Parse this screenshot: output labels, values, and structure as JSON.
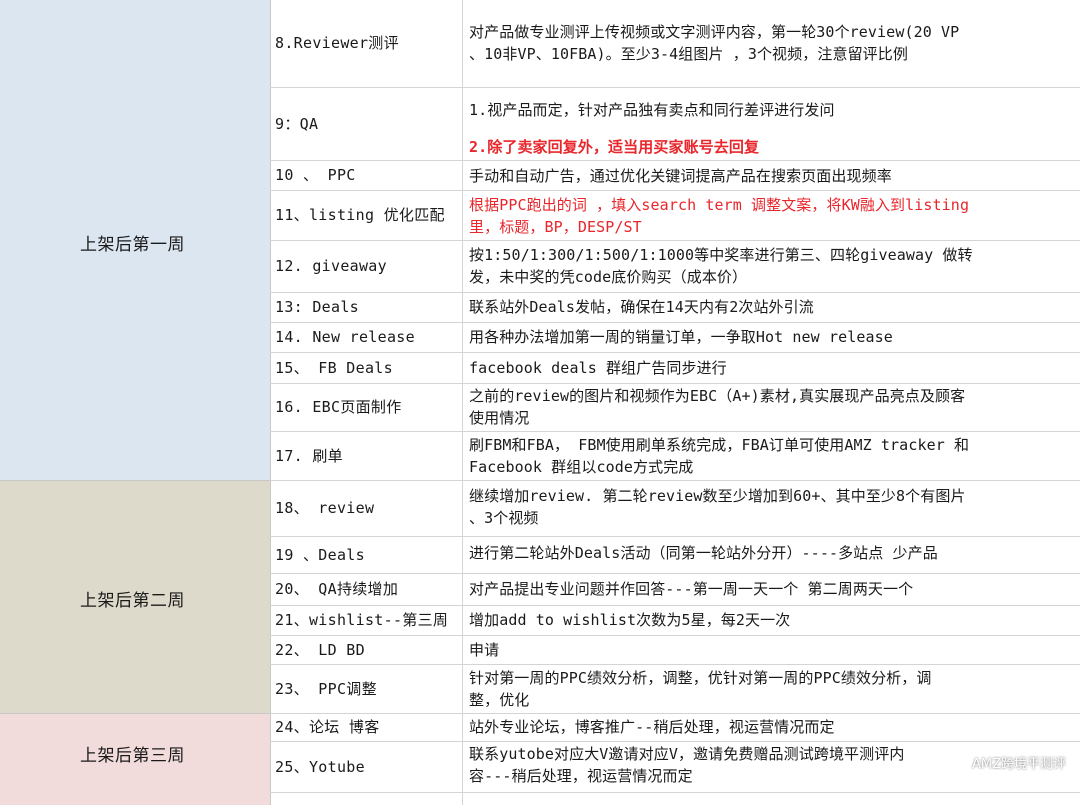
{
  "stages": {
    "week1": "上架后第一周",
    "week2": "上架后第二周",
    "week3": "上架后第三周"
  },
  "colors": {
    "week1": "#dce6f1",
    "week2": "#dedacb",
    "week3": "#f2dcdb",
    "red_text": "#e8262b"
  },
  "rows": [
    {
      "task": "8.Reviewer测评",
      "desc": "对产品做专业测评上传视频或文字测评内容，第一轮30个review(20 VP\n、10非VP、10FBA)。至少3-4组图片 ，3个视频，注意留评比例"
    },
    {
      "task": "9：QA",
      "desc": "1.视产品而定，针对产品独有卖点和同行差评进行发问",
      "desc2": "2.除了卖家回复外，适当用买家账号去回复"
    },
    {
      "task": "10 、 PPC",
      "desc": "手动和自动广告，通过优化关键词提高产品在搜索页面出现频率"
    },
    {
      "task": "11、listing 优化匹配",
      "desc": "根据PPC跑出的词 ，填入search term 调整文案，将KW融入到listing\n里，标题，BP，DESP/ST"
    },
    {
      "task": "12. giveaway",
      "desc": "按1:50/1:300/1:500/1:1000等中奖率进行第三、四轮giveaway 做转\n发，未中奖的凭code底价购买（成本价）"
    },
    {
      "task": "13: Deals",
      "desc": "联系站外Deals发帖，确保在14天内有2次站外引流"
    },
    {
      "task": "14. New release",
      "desc": "用各种办法增加第一周的销量订单，一争取Hot new release"
    },
    {
      "task": "15、 FB Deals",
      "desc": "facebook deals 群组广告同步进行"
    },
    {
      "task": "16. EBC页面制作",
      "desc": "之前的review的图片和视频作为EBC（A+)素材,真实展现产品亮点及顾客\n使用情况"
    },
    {
      "task": "17. 刷单",
      "desc": "刷FBM和FBA， FBM使用刷单系统完成，FBA订单可使用AMZ tracker 和\nFacebook 群组以code方式完成"
    },
    {
      "task": "18、 review",
      "desc": "继续增加review. 第二轮review数至少增加到60+、其中至少8个有图片\n、3个视频"
    },
    {
      "task": "19 、Deals",
      "desc": "进行第二轮站外Deals活动（同第一轮站外分开）----多站点 少产品"
    },
    {
      "task": "20、 QA持续增加",
      "desc": "对产品提出专业问题并作回答---第一周一天一个 第二周两天一个"
    },
    {
      "task": "21、wishlist--第三周",
      "desc": "增加add to wishlist次数为5星，每2天一次"
    },
    {
      "task": "22、 LD BD",
      "desc": "申请"
    },
    {
      "task": "23、 PPC调整",
      "desc": "针对第一周的PPC绩效分析，调整，优针对第一周的PPC绩效分析，调\n整，优化"
    },
    {
      "task": "24、论坛 博客",
      "desc": "站外专业论坛，博客推广--稍后处理，视运营情况而定"
    },
    {
      "task": "25、Yotube",
      "desc": "联系yutobe对应大V邀请对应V，邀请免费赠品测试跨境平测评内\n容---稍后处理，视运营情况而定"
    }
  ],
  "watermark": "AMZ跨境平测评"
}
